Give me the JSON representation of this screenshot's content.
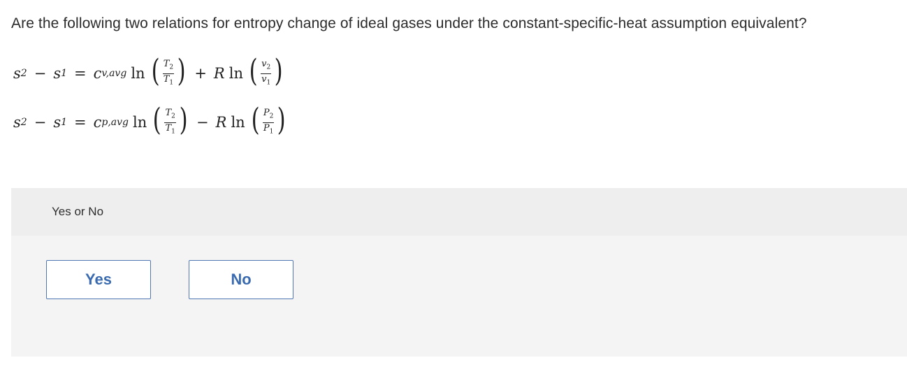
{
  "question": "Are the following two relations for entropy change of ideal gases under the constant-specific-heat assumption equivalent?",
  "equation1": {
    "s2": "s",
    "s2_sub": "2",
    "minus": "−",
    "s1": "s",
    "s1_sub": "1",
    "equals": "=",
    "c": "c",
    "c_sub": "v,avg",
    "ln": "ln",
    "frac1_num": "T",
    "frac1_num_sub": "2",
    "frac1_den": "T",
    "frac1_den_sub": "1",
    "op": "+",
    "R": "R",
    "ln2": "ln",
    "frac2_num": "v",
    "frac2_num_sub": "2",
    "frac2_den": "v",
    "frac2_den_sub": "1"
  },
  "equation2": {
    "s2": "s",
    "s2_sub": "2",
    "minus": "−",
    "s1": "s",
    "s1_sub": "1",
    "equals": "=",
    "c": "c",
    "c_sub": "p,avg",
    "ln": "ln",
    "frac1_num": "T",
    "frac1_num_sub": "2",
    "frac1_den": "T",
    "frac1_den_sub": "1",
    "op": "−",
    "R": "R",
    "ln2": "ln",
    "frac2_num": "P",
    "frac2_num_sub": "2",
    "frac2_den": "P",
    "frac2_den_sub": "1"
  },
  "prompt": "Yes or No",
  "choices": {
    "yes": "Yes",
    "no": "No"
  },
  "colors": {
    "accent": "#3a6bb0",
    "prompt_bg": "#eeeeee",
    "answer_bg": "#f4f4f4"
  }
}
